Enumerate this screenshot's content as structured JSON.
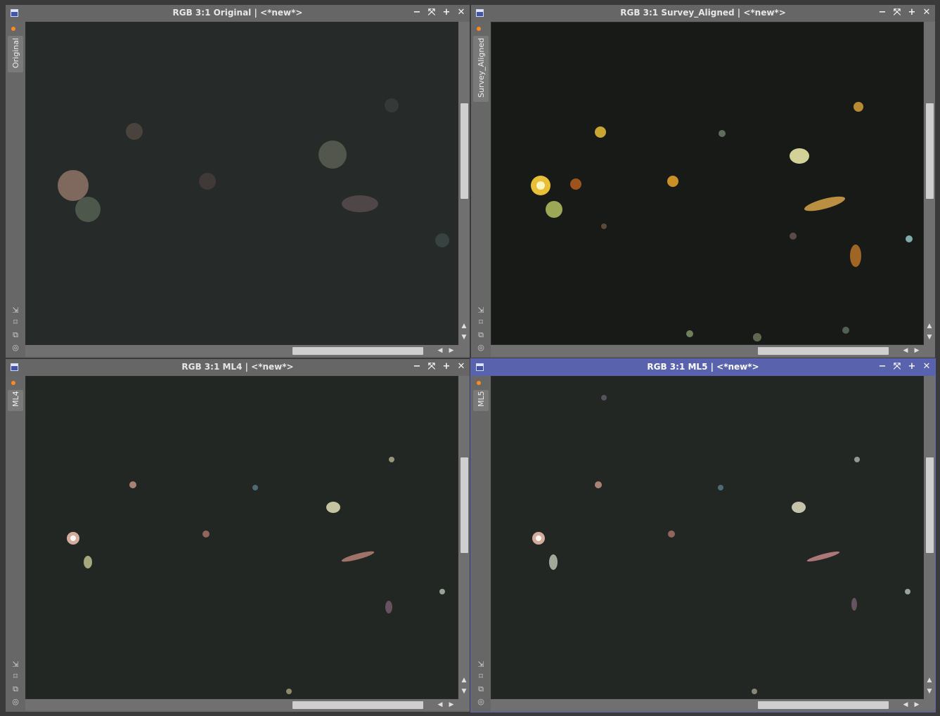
{
  "windows": [
    {
      "id": "original",
      "title": "RGB 3:1 Original | <*new*>",
      "tab_label": "Original",
      "active": false,
      "bg": "#262a28"
    },
    {
      "id": "survey",
      "title": "RGB 3:1 Survey_Aligned | <*new*>",
      "tab_label": "Survey_Aligned",
      "active": false,
      "bg": "#181a18"
    },
    {
      "id": "ml4",
      "title": "RGB 3:1 ML4 | <*new*>",
      "tab_label": "ML4",
      "active": false,
      "bg": "#232724"
    },
    {
      "id": "ml5",
      "title": "RGB 3:1 ML5 | <*new*>",
      "tab_label": "ML5",
      "active": true,
      "bg": "#232724"
    }
  ],
  "titlebar_buttons": [
    "−",
    "⤧",
    "+",
    "✕"
  ],
  "side_icons": [
    "⇲",
    "⌑",
    "⧉",
    "◎"
  ],
  "colors": {
    "accent_active_title": "#5862ad",
    "status_dot": "#ff8a1c"
  }
}
